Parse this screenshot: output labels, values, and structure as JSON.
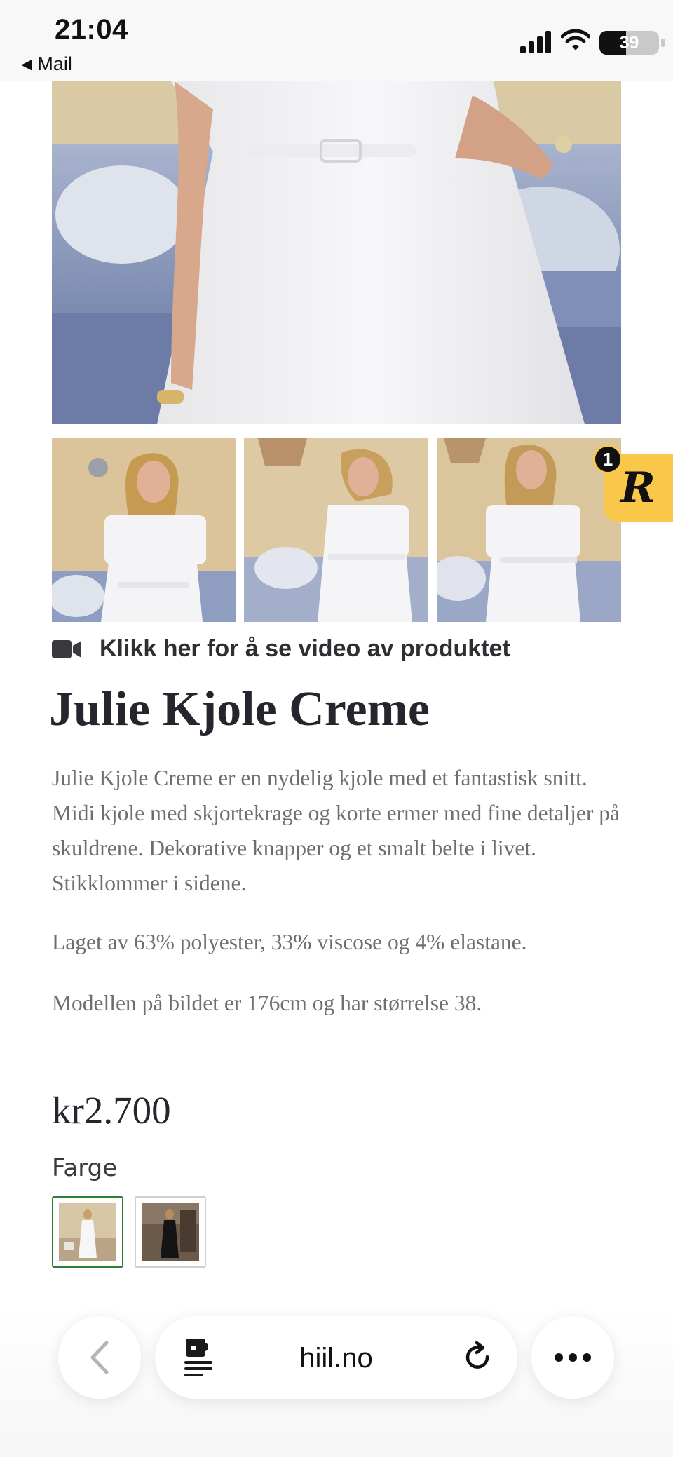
{
  "status_bar": {
    "time": "21:04",
    "back_app": "Mail",
    "battery": "39"
  },
  "product": {
    "video_link": "Klikk her for å se video av produktet",
    "title": "Julie Kjole Creme",
    "description": [
      "Julie Kjole Creme er en nydelig kjole med et fantastisk snitt. Midi kjole med skjortekrage og korte ermer med fine detaljer på skuldrene. Dekorative knapper og  et smalt belte i livet. Stikklommer i sidene.",
      "Laget av 63% polyester, 33% viscose og 4% elastane.",
      "Modellen på bildet er 176cm og har størrelse 38."
    ],
    "price": "kr2.700",
    "color_label": "Farge",
    "color_options": [
      {
        "name": "Creme",
        "selected": true
      },
      {
        "name": "Black",
        "selected": false
      }
    ]
  },
  "badge": {
    "letter": "R",
    "count": "1",
    "color": "#f9c84a"
  },
  "browser": {
    "url": "hiil.no"
  },
  "colors": {
    "selected_swatch_border": "#2e7d32",
    "title_text": "#25252d",
    "body_text": "#6e6e6e"
  }
}
